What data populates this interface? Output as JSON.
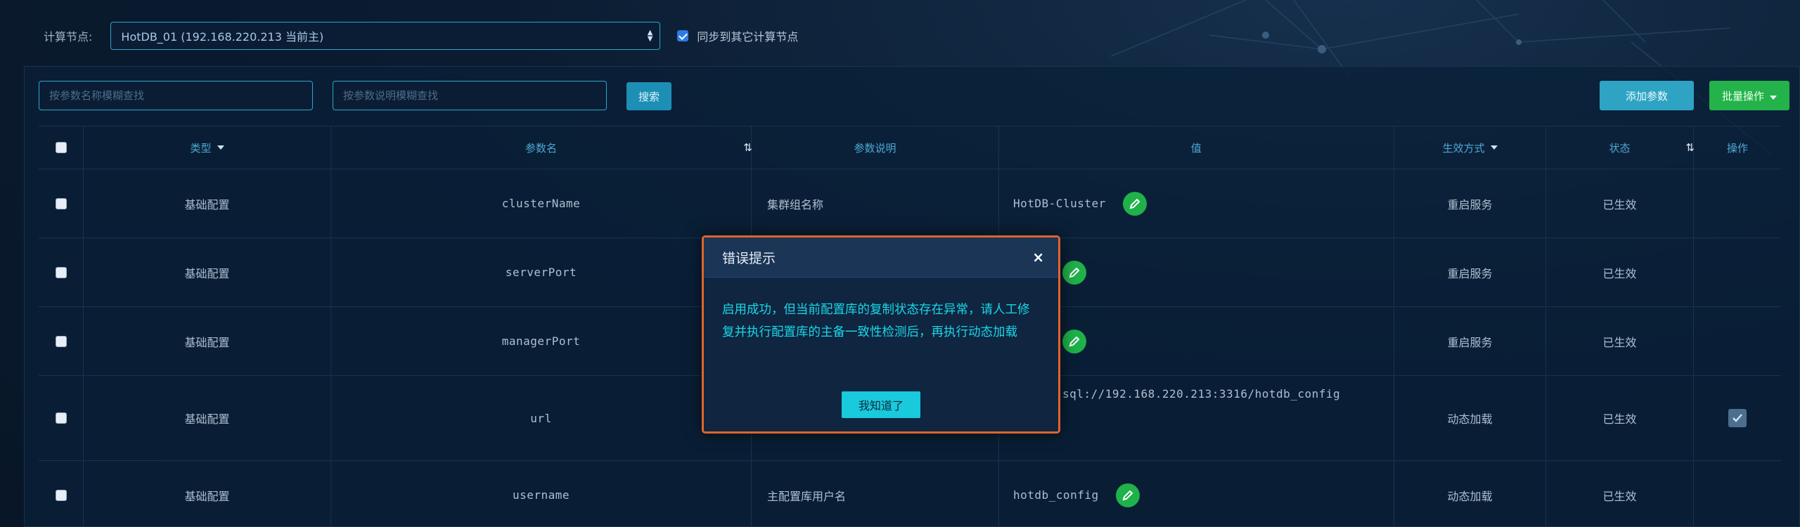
{
  "node": {
    "label": "计算节点:",
    "selected": "HotDB_01  (192.168.220.213 当前主)",
    "sync_label": "同步到其它计算节点",
    "sync_checked": true
  },
  "toolbar": {
    "search_name_placeholder": "按参数名称模糊查找",
    "search_desc_placeholder": "按参数说明模糊查找",
    "search_label": "搜索",
    "add_label": "添加参数",
    "batch_label": "批量操作"
  },
  "table": {
    "headers": {
      "type": "类型",
      "name": "参数名",
      "desc": "参数说明",
      "value": "值",
      "effect": "生效方式",
      "status": "状态",
      "op": "操作"
    },
    "rows": [
      {
        "type": "基础配置",
        "name": "clusterName",
        "desc": "集群组名称",
        "value": "HotDB-Cluster",
        "effect": "重启服务",
        "status": "已生效"
      },
      {
        "type": "基础配置",
        "name": "serverPort",
        "desc": "",
        "value": "",
        "effect": "重启服务",
        "status": "已生效"
      },
      {
        "type": "基础配置",
        "name": "managerPort",
        "desc": "",
        "value": "",
        "effect": "重启服务",
        "status": "已生效"
      },
      {
        "type": "基础配置",
        "name": "url",
        "desc": "",
        "value": "sql://192.168.220.213:3316/hotdb_config",
        "effect": "动态加载",
        "status": "已生效"
      },
      {
        "type": "基础配置",
        "name": "username",
        "desc": "主配置库用户名",
        "value": "hotdb_config",
        "effect": "动态加载",
        "status": "已生效"
      }
    ]
  },
  "dialog": {
    "title": "错误提示",
    "close": "×",
    "message": "启用成功，但当前配置库的复制状态存在异常，请人工修复并执行配置库的主备一致性检测后，再执行动态加载",
    "ok_label": "我知道了"
  },
  "colors": {
    "accent": "#2aa7c9",
    "success": "#24b24a",
    "dialog_border": "#e0642c",
    "dialog_text": "#19d6e6"
  }
}
